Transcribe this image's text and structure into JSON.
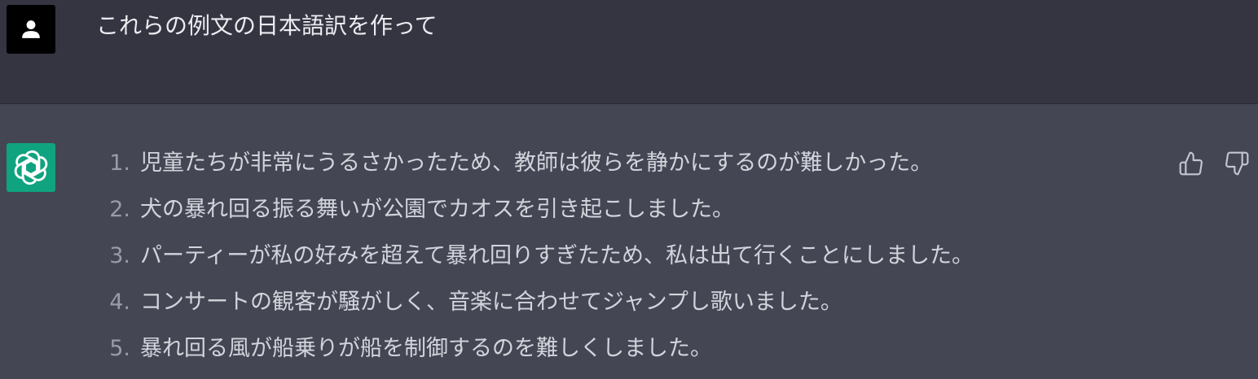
{
  "user": {
    "avatar_icon": "user-silhouette-icon",
    "message": "これらの例文の日本語訳を作って"
  },
  "assistant": {
    "avatar_icon": "openai-logo-icon",
    "items": [
      {
        "num": "1.",
        "text": "児童たちが非常にうるさかったため、教師は彼らを静かにするのが難しかった。"
      },
      {
        "num": "2.",
        "text": "犬の暴れ回る振る舞いが公園でカオスを引き起こしました。"
      },
      {
        "num": "3.",
        "text": "パーティーが私の好みを超えて暴れ回りすぎたため、私は出て行くことにしました。"
      },
      {
        "num": "4.",
        "text": "コンサートの観客が騒がしく、音楽に合わせてジャンプし歌いました。"
      },
      {
        "num": "5.",
        "text": "暴れ回る風が船乗りが船を制御するのを難しくしました。"
      }
    ],
    "feedback": {
      "thumbs_up_icon": "thumbs-up-icon",
      "thumbs_down_icon": "thumbs-down-icon"
    }
  },
  "colors": {
    "user_bg": "#343541",
    "assistant_bg": "#444654",
    "accent": "#10a37f",
    "text": "#d1d5db"
  }
}
